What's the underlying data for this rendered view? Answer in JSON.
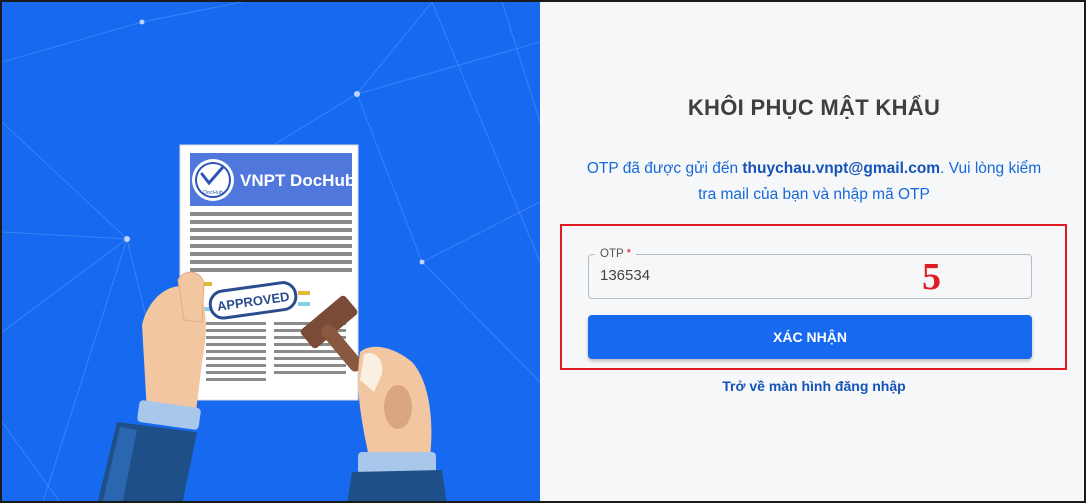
{
  "illustration": {
    "brand_name": "VNPT DocHub",
    "stamp_text": "APPROVED",
    "logo_small_text": "DocHub"
  },
  "form": {
    "title": "KHÔI PHỤC MẬT KHẨU",
    "message_prefix": "OTP đã được gửi đến ",
    "message_email": "thuychau.vnpt@gmail.com",
    "message_suffix": ". Vui lòng kiểm tra mail của bạn và nhập mã OTP",
    "otp_label": "OTP",
    "otp_required_mark": "*",
    "otp_value": "136534",
    "step_number": "5",
    "confirm_label": "XÁC NHẬN",
    "back_link": "Trở về màn hình đăng nhập"
  },
  "colors": {
    "brand_blue": "#1769f0",
    "highlight_red": "#e11b24",
    "link_blue": "#1453b8"
  }
}
